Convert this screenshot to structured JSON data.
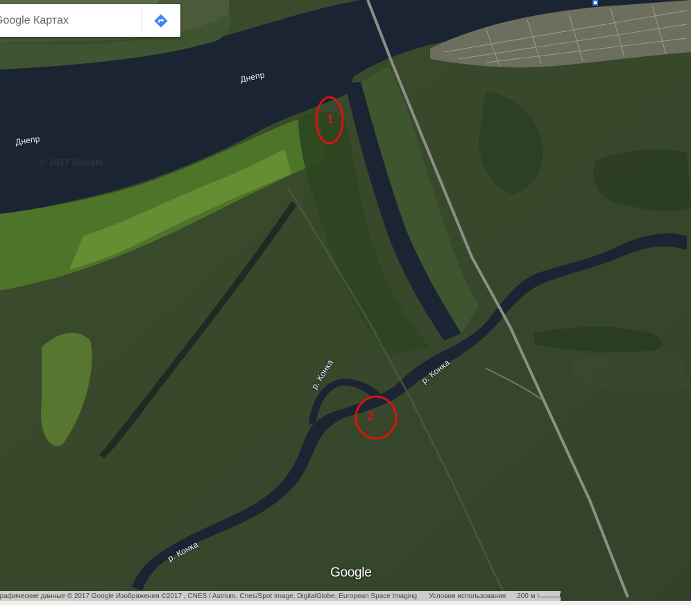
{
  "search": {
    "placeholder": "Google Картах",
    "value": ""
  },
  "icons": {
    "directions": "directions-icon",
    "pin": "pin-icon"
  },
  "labels": {
    "river_dnepr_1": "Днепр",
    "river_dnepr_2": "Днепр",
    "river_konka_1": "р. Конка",
    "river_konka_2": "р. Конка",
    "river_konka_3": "р. Конка"
  },
  "markers": [
    {
      "id": "1",
      "label": "1"
    },
    {
      "id": "2",
      "label": "2"
    }
  ],
  "watermark": "© 2017 Google",
  "google_logo": "Google",
  "attribution": {
    "text": "графические данные © 2017 Google Изображения ©2017 , CNES / Astrium, Cnes/Spot Image, DigitalGlobe, European Space Imaging",
    "terms": "Условия использования",
    "scale": "200 м"
  },
  "colors": {
    "water": "#1b2433",
    "land": "#3a4a2c",
    "marker": "#e01010",
    "road": "#8e8e88"
  }
}
